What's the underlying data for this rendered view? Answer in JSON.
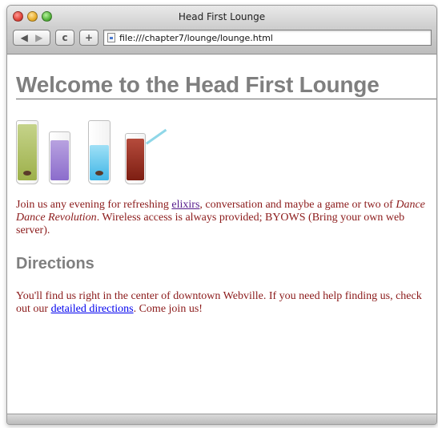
{
  "window": {
    "title": "Head First Lounge"
  },
  "toolbar": {
    "back_icon": "back-arrow-icon",
    "forward_icon": "forward-arrow-icon",
    "reload_glyph": "c",
    "add_glyph": "+",
    "address": "file:///chapter7/lounge/lounge.html"
  },
  "page": {
    "heading": "Welcome to the Head First Lounge",
    "intro": {
      "before_link": "Join us any evening for refreshing ",
      "link": "elixirs",
      "after_link": ", conversation and maybe a game or two of ",
      "italic": "Dance Dance Revolution",
      "end": ". Wireless access is always provided; BYOWS (Bring your own web server)."
    },
    "directions_heading": "Directions",
    "directions": {
      "before_link": "You'll find us right in the center of downtown Webville. If you need help finding us, check out our ",
      "link": "detailed directions",
      "end": ". Come join us!"
    }
  },
  "colors": {
    "text": "#8b1a1a",
    "heading": "#7f7f7f",
    "link": "#0000ee",
    "visited_link": "#551a8b"
  }
}
